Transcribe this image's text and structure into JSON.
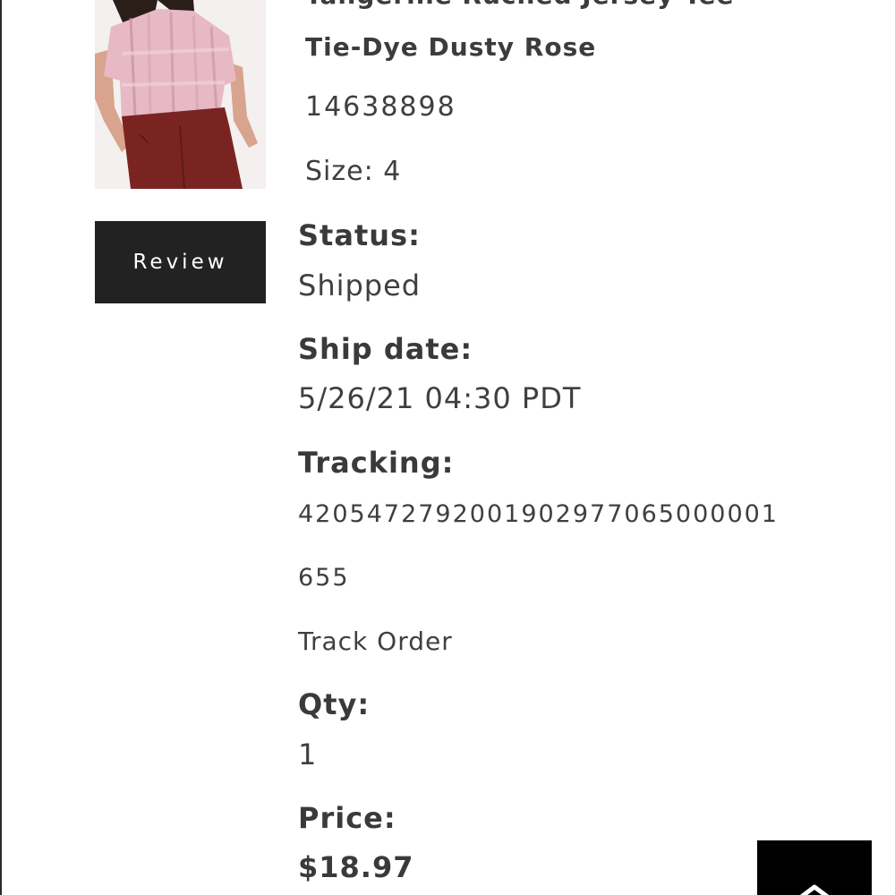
{
  "product": {
    "color_name": "Tie-Dye Dusty Rose",
    "sku": "14638898",
    "size": "Size: 4"
  },
  "review_button": {
    "label": "Review"
  },
  "status": {
    "label": "Status:",
    "value": "Shipped"
  },
  "ship_date": {
    "label": "Ship date:",
    "value": "5/26/21 04:30 PDT"
  },
  "tracking": {
    "label": "Tracking:",
    "number_line1": "4205472792001902977065000001",
    "number_line2": "655",
    "link_label": "Track Order"
  },
  "qty": {
    "label": "Qty:",
    "value": "1"
  },
  "price": {
    "label": "Price:",
    "value": "$18.97"
  },
  "icons": {
    "back_to_top": "chevron-up-icon"
  },
  "colors": {
    "button_dark": "#222222",
    "text": "#3a3a3a",
    "back_to_top_bg": "#000000"
  }
}
